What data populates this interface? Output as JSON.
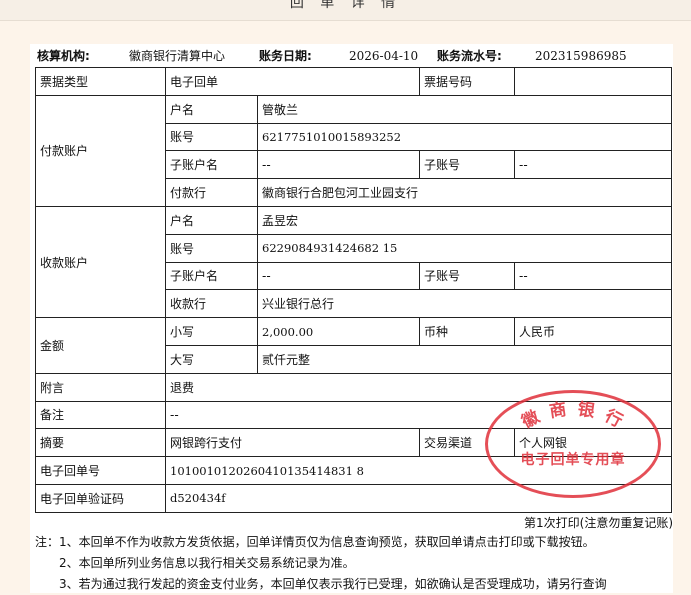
{
  "window": {
    "title": "回 单 详 情"
  },
  "header": {
    "org_label": "核算机构:",
    "org_value": "徽商银行清算中心",
    "date_label": "账务日期:",
    "date_value": "2026-04-10",
    "serial_label": "账务流水号:",
    "serial_value": "202315986985"
  },
  "receipt": {
    "bill_type_label": "票据类型",
    "bill_type_value": "电子回单",
    "bill_no_label": "票据号码",
    "bill_no_value": "",
    "payer": {
      "section_label": "付款账户",
      "name_label": "户名",
      "name_value": "管敬兰",
      "account_label": "账号",
      "account_value": "6217751010015893252",
      "sub_name_label": "子账户名",
      "sub_name_value": "--",
      "sub_no_label": "子账号",
      "sub_no_value": "--",
      "bank_label": "付款行",
      "bank_value": "徽商银行合肥包河工业园支行"
    },
    "payee": {
      "section_label": "收款账户",
      "name_label": "户名",
      "name_value": "孟昱宏",
      "account_label": "账号",
      "account_value": "6229084931424682 15",
      "sub_name_label": "子账户名",
      "sub_name_value": "--",
      "sub_no_label": "子账号",
      "sub_no_value": "--",
      "bank_label": "收款行",
      "bank_value": "兴业银行总行"
    },
    "amount": {
      "section_label": "金额",
      "small_label": "小写",
      "small_value": "2,000.00",
      "currency_label": "币种",
      "currency_value": "人民币",
      "big_label": "大写",
      "big_value": "贰仟元整"
    },
    "postscript_label": "附言",
    "postscript_value": "退费",
    "remark_label": "备注",
    "remark_value": "--",
    "summary_label": "摘要",
    "summary_value": "网银跨行支付",
    "channel_label": "交易渠道",
    "channel_value": "个人网银",
    "ereceipt_no_label": "电子回单号",
    "ereceipt_no_value": "1010010120260410135414831 8",
    "verify_label": "电子回单验证码",
    "verify_value": "d520434f"
  },
  "stamp": {
    "top_text": "徽 商 银 行",
    "bottom_text": "电子回单专用章"
  },
  "print_info": "第1次打印(注意勿重复记账)",
  "notes": [
    "注：1、本回单不作为收款方发货依据，回单详情页仅为信息查询预览，获取回单请点击打印或下载按钮。",
    "2、本回单所列业务信息以我行相关交易系统记录为准。",
    "3、若为通过我行发起的资金支付业务，本回单仅表示我行已受理，如欲确认是否受理成功，请另行查询"
  ]
}
